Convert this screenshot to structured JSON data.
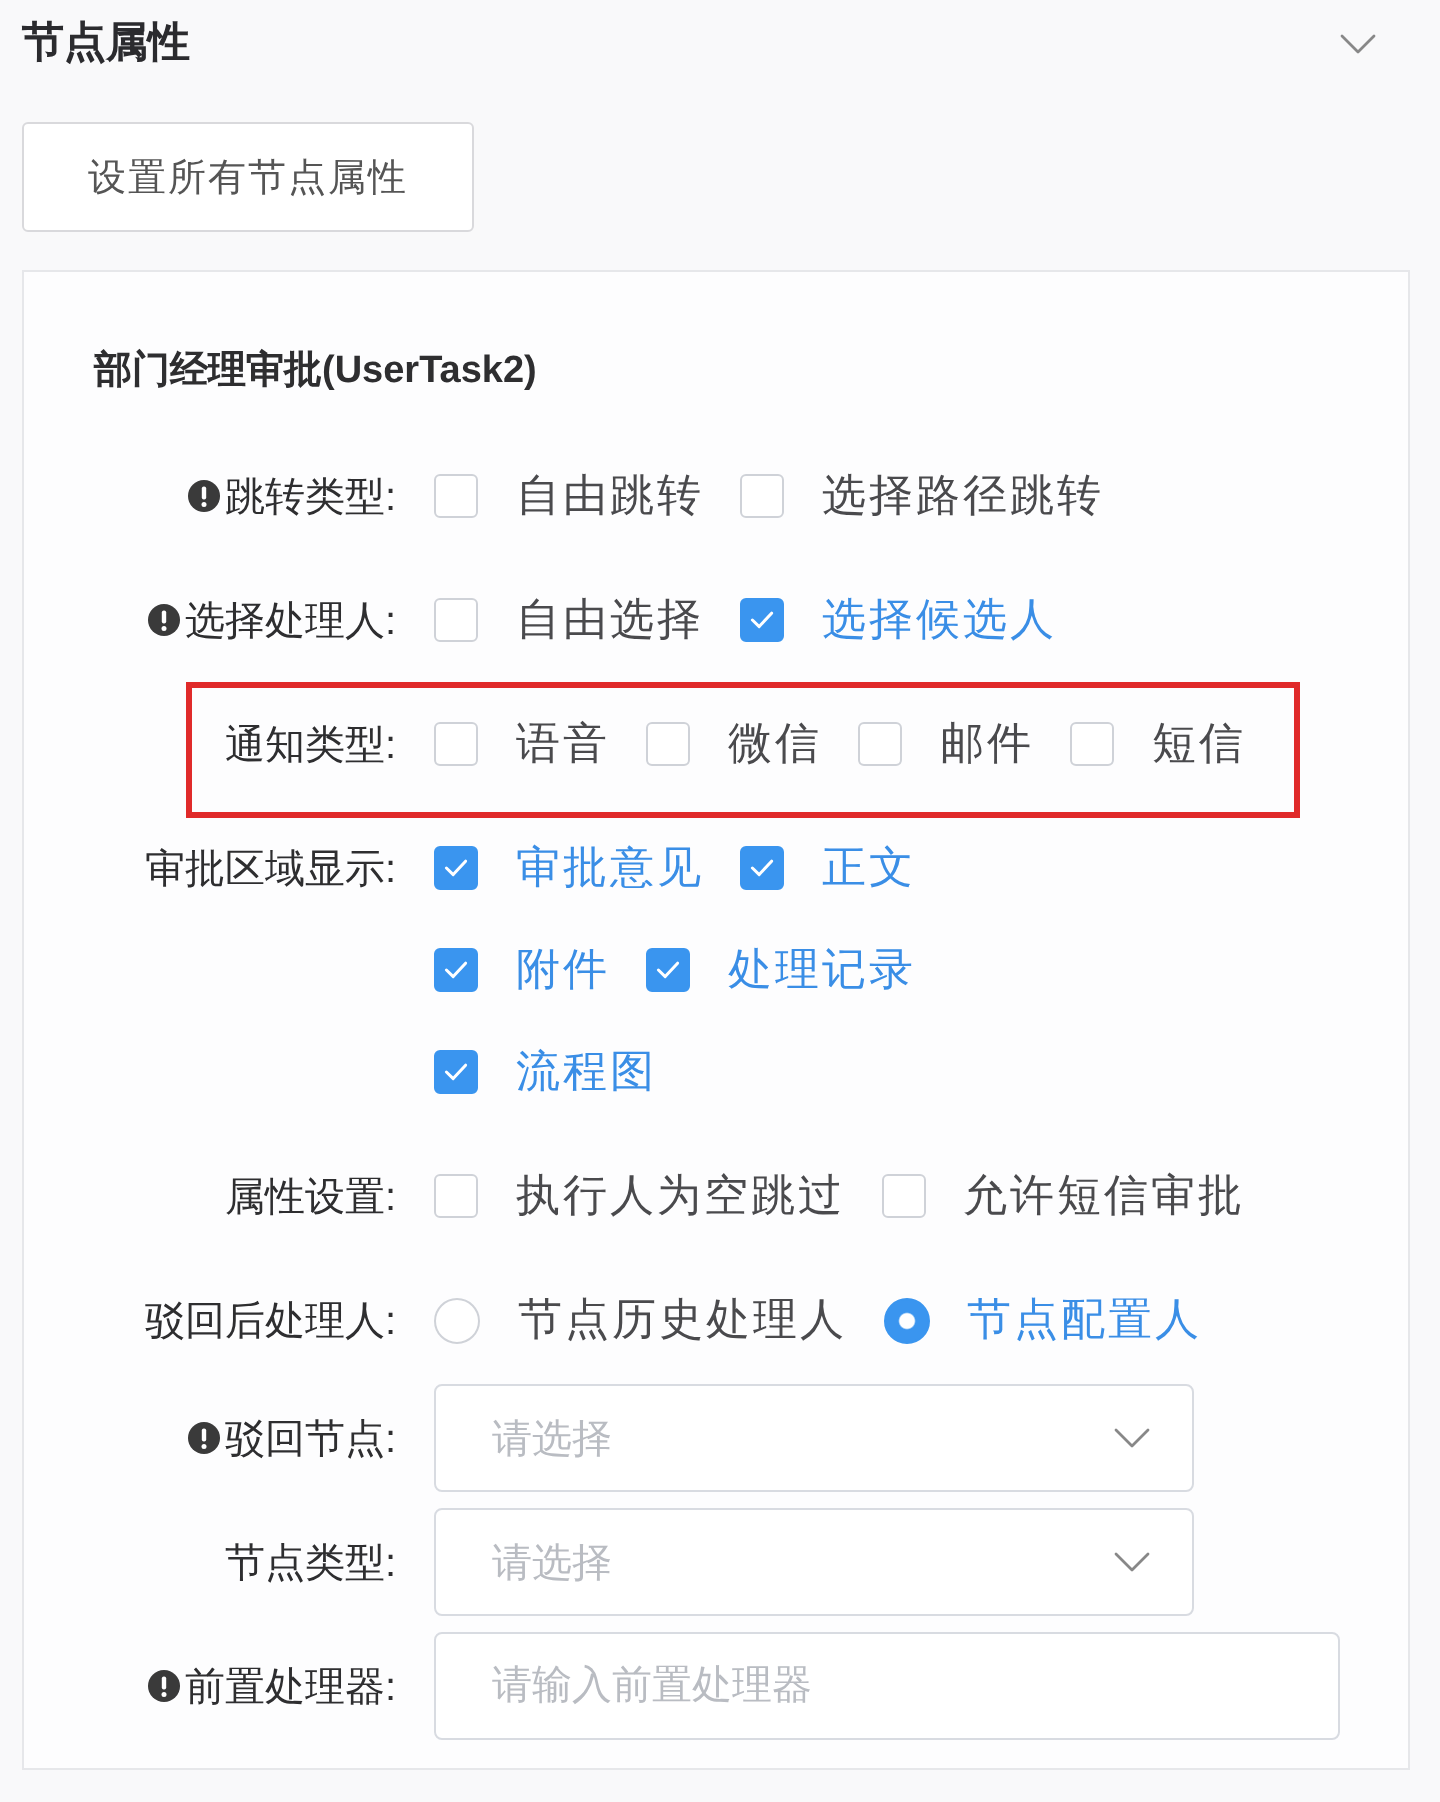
{
  "panel": {
    "title": "节点属性",
    "expanded": true
  },
  "toolbar": {
    "button": "设置所有节点属性"
  },
  "node": {
    "title": "部门经理审批(UserTask2)",
    "fields": [
      {
        "kind": "checkboxes",
        "label": "跳转类型:",
        "required": true,
        "highlighted": false,
        "lines": [
          [
            {
              "label": "自由跳转",
              "checked": false
            },
            {
              "label": "选择路径跳转",
              "checked": false
            }
          ]
        ]
      },
      {
        "kind": "checkboxes",
        "label": "选择处理人:",
        "required": true,
        "highlighted": false,
        "lines": [
          [
            {
              "label": "自由选择",
              "checked": false
            },
            {
              "label": "选择候选人",
              "checked": true
            }
          ]
        ]
      },
      {
        "kind": "checkboxes",
        "label": "通知类型:",
        "required": false,
        "highlighted": true,
        "lines": [
          [
            {
              "label": "语音",
              "checked": false
            },
            {
              "label": "微信",
              "checked": false
            },
            {
              "label": "邮件",
              "checked": false
            },
            {
              "label": "短信",
              "checked": false
            }
          ]
        ]
      },
      {
        "kind": "checkboxes",
        "label": "审批区域显示:",
        "required": false,
        "highlighted": false,
        "lines": [
          [
            {
              "label": "审批意见",
              "checked": true
            },
            {
              "label": "正文",
              "checked": true
            }
          ],
          [
            {
              "label": "附件",
              "checked": true
            },
            {
              "label": "处理记录",
              "checked": true
            }
          ],
          [
            {
              "label": "流程图",
              "checked": true
            }
          ]
        ]
      },
      {
        "kind": "checkboxes",
        "label": "属性设置:",
        "required": false,
        "highlighted": false,
        "lines": [
          [
            {
              "label": "执行人为空跳过",
              "checked": false
            },
            {
              "label": "允许短信审批",
              "checked": false
            }
          ]
        ]
      },
      {
        "kind": "radios",
        "label": "驳回后处理人:",
        "required": false,
        "highlighted": false,
        "options": [
          {
            "label": "节点历史处理人",
            "selected": false
          },
          {
            "label": "节点配置人",
            "selected": true
          }
        ]
      },
      {
        "kind": "select",
        "label": "驳回节点:",
        "required": true,
        "highlighted": false,
        "placeholder": "请选择"
      },
      {
        "kind": "select",
        "label": "节点类型:",
        "required": false,
        "highlighted": false,
        "placeholder": "请选择"
      },
      {
        "kind": "input",
        "label": "前置处理器:",
        "required": true,
        "highlighted": false,
        "placeholder": "请输入前置处理器"
      }
    ]
  }
}
